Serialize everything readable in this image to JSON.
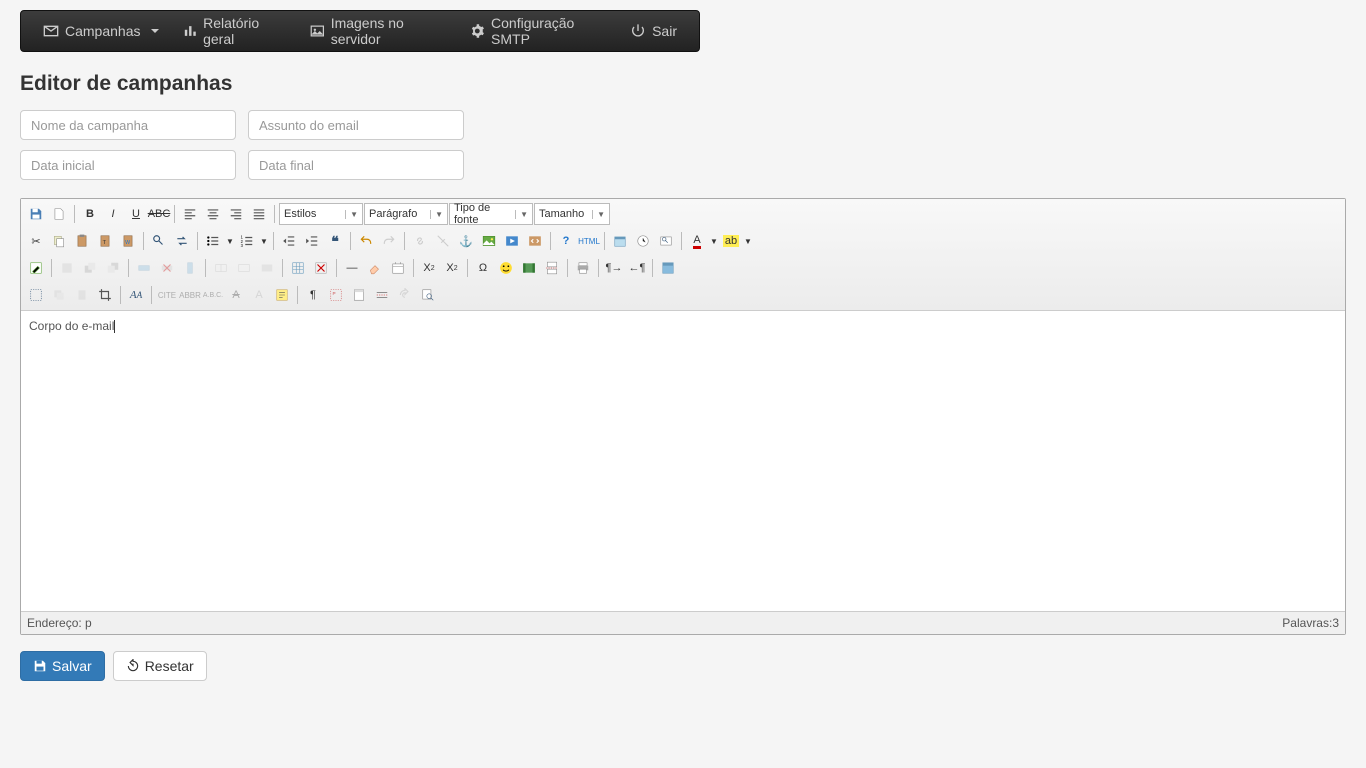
{
  "nav": {
    "campanhas": "Campanhas",
    "relatorio": "Relatório geral",
    "imagens": "Imagens no servidor",
    "config": "Configuração SMTP",
    "sair": "Sair"
  },
  "page": {
    "title": "Editor de campanhas"
  },
  "form": {
    "nome_placeholder": "Nome da campanha",
    "assunto_placeholder": "Assunto do email",
    "data_inicial_placeholder": "Data inicial",
    "data_final_placeholder": "Data final"
  },
  "editor": {
    "styles_label": "Estilos",
    "paragraph_label": "Parágrafo",
    "font_label": "Tipo de fonte",
    "size_label": "Tamanho",
    "body_text": "Corpo do e-mail",
    "path_label": "Endereço: p",
    "word_count_label": "Palavras:3"
  },
  "actions": {
    "save": "Salvar",
    "reset": "Resetar"
  }
}
